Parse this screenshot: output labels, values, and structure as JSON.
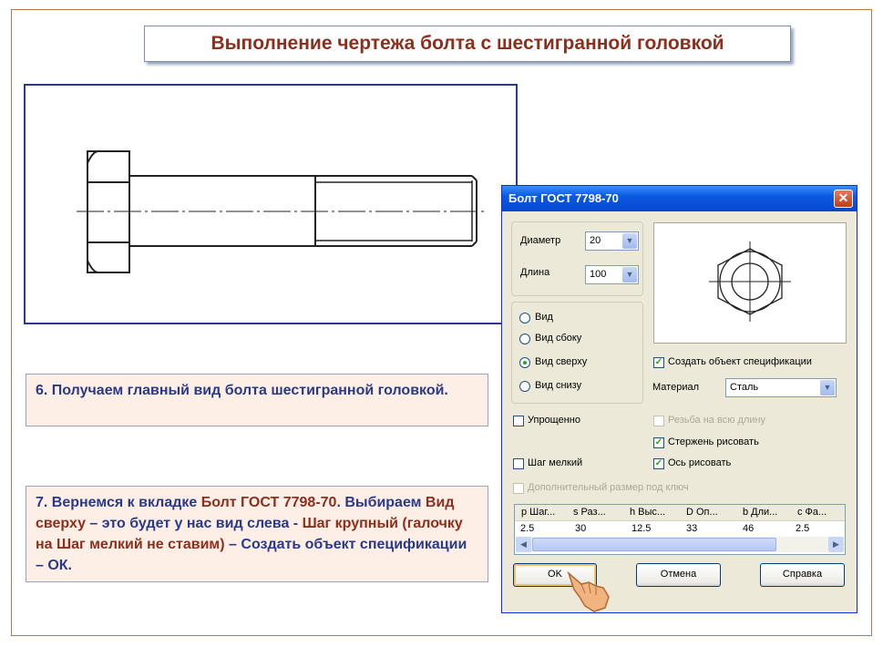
{
  "slide": {
    "title": "Выполнение чертежа болта с шестигранной головкой",
    "note6": "6. Получаем главный вид болта шестигранной головкой.",
    "note7": {
      "p1": "7. Вернемся к вкладке ",
      "h1": "Болт ГОСТ 7798-70",
      "p2": ". Выбираем ",
      "h2": "Вид сверху",
      "p3": " – это будет у нас вид слева - ",
      "h3": "Шаг крупный (галочку на Шаг мелкий не ставим)",
      "p4": " – Создать объект спецификации – ОК."
    }
  },
  "dialog": {
    "title": "Болт ГОСТ 7798-70",
    "close_icon": "close-icon",
    "diameter_label": "Диаметр",
    "diameter_value": "20",
    "length_label": "Длина",
    "length_value": "100",
    "views": [
      {
        "label": "Вид",
        "selected": false
      },
      {
        "label": "Вид сбоку",
        "selected": false
      },
      {
        "label": "Вид сверху",
        "selected": true
      },
      {
        "label": "Вид снизу",
        "selected": false
      }
    ],
    "create_spec_label": "Создать объект спецификации",
    "material_label": "Материал",
    "material_value": "Сталь",
    "simplified_label": "Упрощенно",
    "full_thread_label": "Резьба на всю длину",
    "draw_rod_label": "Стержень рисовать",
    "fine_pitch_label": "Шаг мелкий",
    "draw_axis_label": "Ось рисовать",
    "extra_size_label": "Дополнительный размер под ключ",
    "table": {
      "headers": [
        "p Шаг...",
        "s Раз...",
        "h Выс...",
        "D Оп...",
        "b Дли...",
        "c Фа..."
      ],
      "row": [
        "2.5",
        "30",
        "12.5",
        "33",
        "46",
        "2.5"
      ]
    },
    "ok_label": "OK",
    "cancel_label": "Отмена",
    "help_label": "Справка"
  },
  "colors": {
    "title_text": "#8c2f1d",
    "note_text": "#2a3a8a",
    "note_bg": "#fdeee6",
    "dialog_title": "#0a5ae0",
    "drawing_border": "#2a3a8a"
  }
}
